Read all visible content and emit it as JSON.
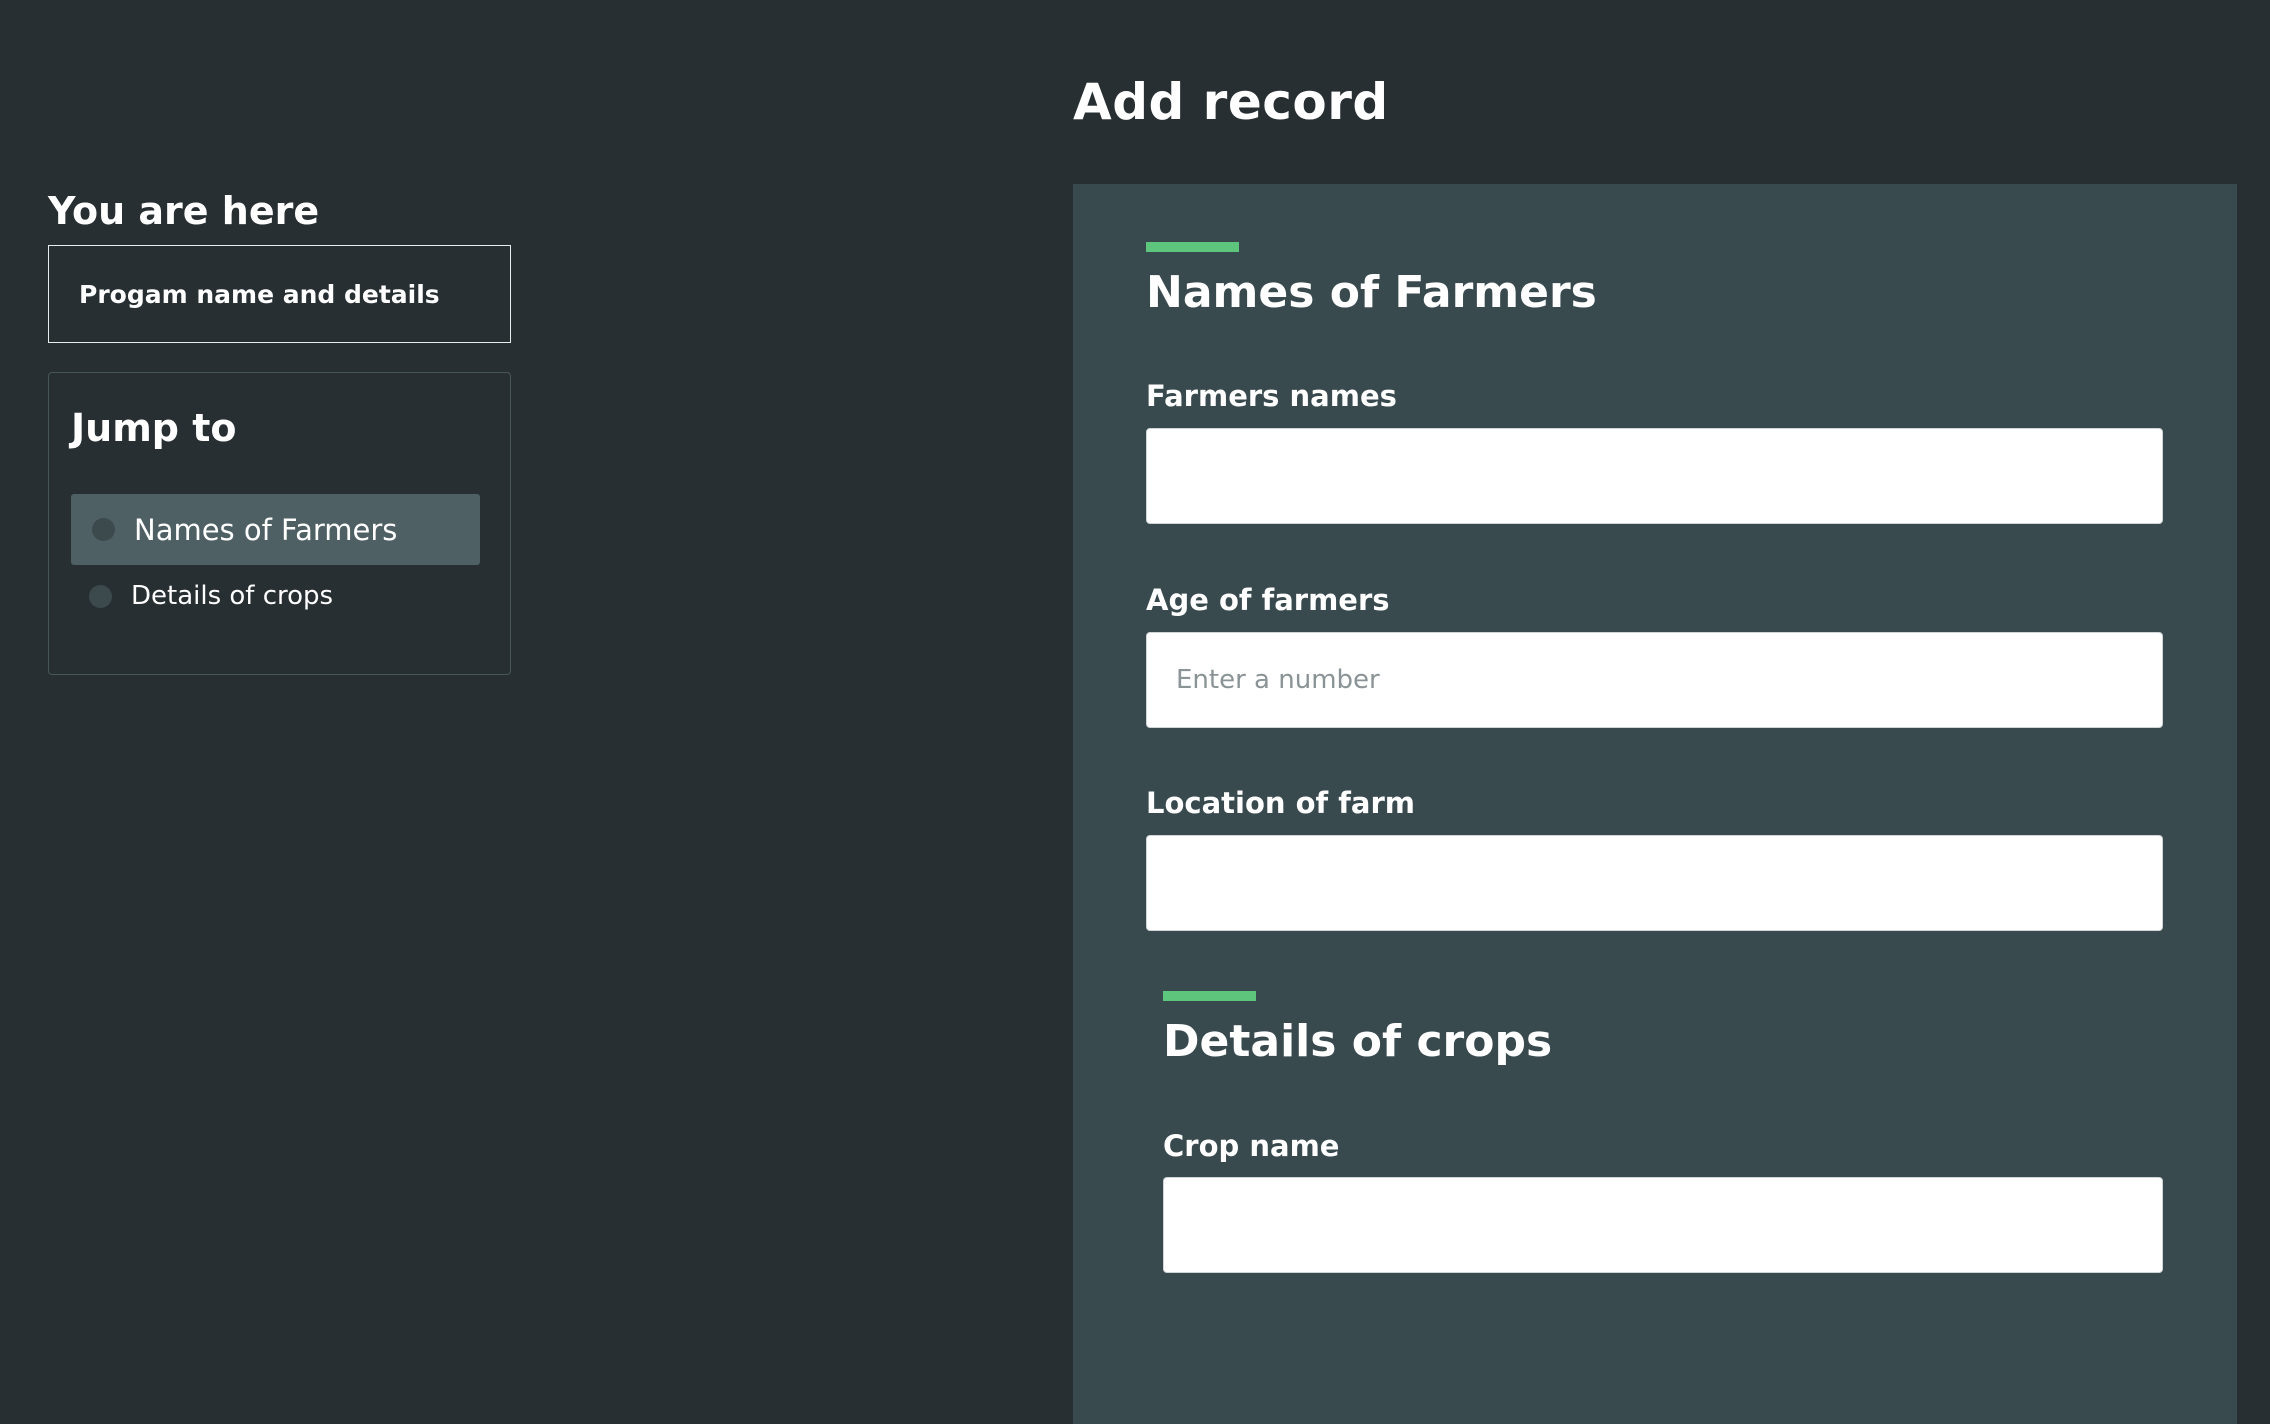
{
  "page": {
    "title": "Add record"
  },
  "sidebar": {
    "you_are_here_heading": "You are here",
    "current_location": "Progam name and details",
    "jump_to_heading": "Jump to",
    "items": [
      {
        "label": "Names of Farmers",
        "active": true
      },
      {
        "label": "Details of crops",
        "active": false
      }
    ]
  },
  "form": {
    "sections": [
      {
        "title": "Names of Farmers",
        "fields": [
          {
            "label": "Farmers names",
            "value": "",
            "placeholder": ""
          },
          {
            "label": "Age of farmers",
            "value": "",
            "placeholder": "Enter a number"
          },
          {
            "label": "Location of farm",
            "value": "",
            "placeholder": ""
          }
        ]
      },
      {
        "title": "Details of crops",
        "fields": [
          {
            "label": "Crop name",
            "value": "",
            "placeholder": ""
          }
        ]
      }
    ]
  },
  "colors": {
    "background": "#272f32",
    "panel": "#394a4f",
    "accent": "#5ec57c",
    "active_item": "#4f6064"
  }
}
